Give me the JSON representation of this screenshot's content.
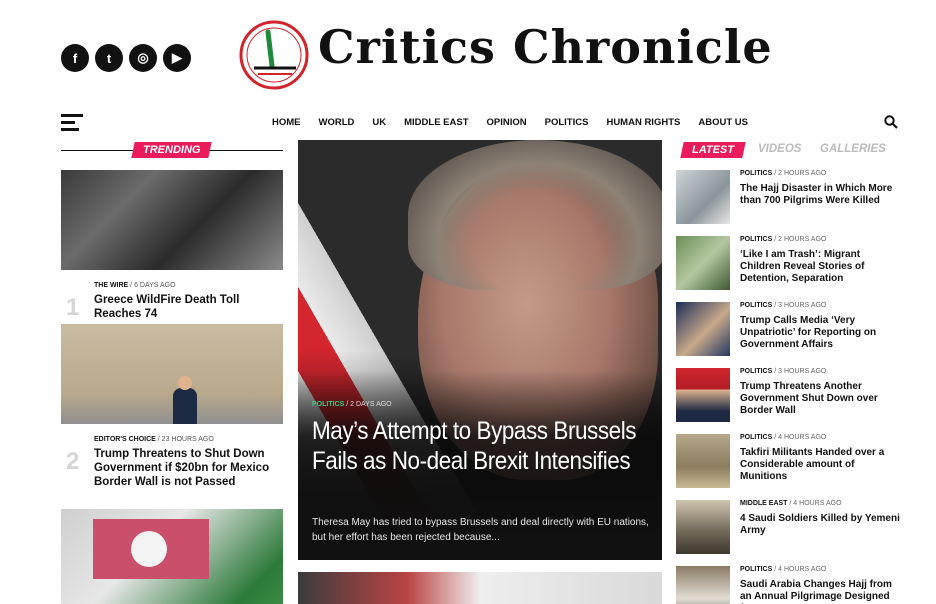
{
  "brand": {
    "name": "Critics Chronicle",
    "accent": "#ec1b5b",
    "hero_cat_color": "#2ed07e"
  },
  "socials": [
    {
      "label": "f",
      "icon": "facebook-icon"
    },
    {
      "label": "t",
      "icon": "twitter-icon"
    },
    {
      "label": "◎",
      "icon": "instagram-icon"
    },
    {
      "label": "▶",
      "icon": "youtube-icon"
    }
  ],
  "nav": {
    "items": [
      "HOME",
      "WORLD",
      "UK",
      "MIDDLE EAST",
      "OPINION",
      "POLITICS",
      "HUMAN RIGHTS",
      "ABOUT US"
    ]
  },
  "trending": {
    "label": "TRENDING",
    "items": [
      {
        "rank": "1",
        "category": "THE WIRE",
        "time": "6 days ago",
        "title": "Greece WildFire Death Toll Reaches 74"
      },
      {
        "rank": "2",
        "category": "EDITOR'S CHOICE",
        "time": "23 hours ago",
        "title": "Trump Threatens to Shut Down Government if $20bn for Mexico Border Wall is not Passed"
      }
    ]
  },
  "hero": {
    "category": "POLITICS",
    "time": "2 days ago",
    "title": "May’s Attempt to Bypass Brussels Fails as No-deal Brexit Intensifies",
    "excerpt": "Theresa May has tried to bypass Brussels and deal directly with EU nations, but her effort has been rejected because..."
  },
  "latest": {
    "tabs": [
      "LATEST",
      "VIDEOS",
      "GALLERIES"
    ],
    "items": [
      {
        "category": "POLITICS",
        "time": "2 hours ago",
        "title": "The Hajj Disaster in Which More than 700 Pilgrims Were Killed"
      },
      {
        "category": "POLITICS",
        "time": "2 hours ago",
        "title": "‘Like I am Trash’: Migrant Children Reveal Stories of Detention, Separation"
      },
      {
        "category": "POLITICS",
        "time": "3 hours ago",
        "title": "Trump Calls Media ‘Very Unpatriotic’ for Reporting on Government Affairs"
      },
      {
        "category": "POLITICS",
        "time": "3 hours ago",
        "title": "Trump Threatens Another Government Shut Down over Border Wall"
      },
      {
        "category": "POLITICS",
        "time": "4 hours ago",
        "title": "Takfiri Militants Handed over a Considerable amount of Munitions"
      },
      {
        "category": "MIDDLE EAST",
        "time": "4 hours ago",
        "title": "4 Saudi Soldiers Killed by Yemeni Army"
      },
      {
        "category": "POLITICS",
        "time": "4 hours ago",
        "title": "Saudi Arabia Changes Hajj from an Annual Pilgrimage Designed for"
      }
    ]
  }
}
